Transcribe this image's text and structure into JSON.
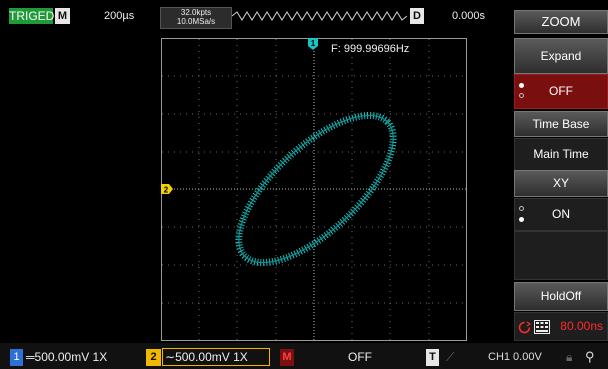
{
  "status": {
    "trigger": "TRIGED",
    "mode": "M"
  },
  "timebase": "200µs",
  "memory": {
    "line1": "32.0kpts",
    "line2": "10.0MSa/s"
  },
  "delay_label": "D",
  "horizontal_position": "0.000s",
  "measurement": {
    "frequency": "F: 999.99696Hz"
  },
  "menu": {
    "title": "ZOOM",
    "expand_windows": "Expand Windows",
    "expand_state": "OFF",
    "time_base": "Time Base",
    "main_time": "Main Time",
    "xy": "XY",
    "xy_state": "ON",
    "holdoff": "HoldOff",
    "holdoff_value": "80.00ns"
  },
  "markers": {
    "ch1": "1",
    "ch2": "2"
  },
  "bottom": {
    "ch1_number": "1",
    "ch1_setting": "500.00mV  1X",
    "ch2_number": "2",
    "ch2_setting": "500.00mV  1X",
    "math_label": "M",
    "math_state": "OFF",
    "trigger_label": "T",
    "trigger_setting": "CH1 0.00V"
  },
  "colors": {
    "trace": "#16c4c4",
    "triged": "#1f9a38",
    "ch1": "#2e6fd8",
    "ch2": "#f2b800",
    "alert": "#ff2a2a"
  }
}
